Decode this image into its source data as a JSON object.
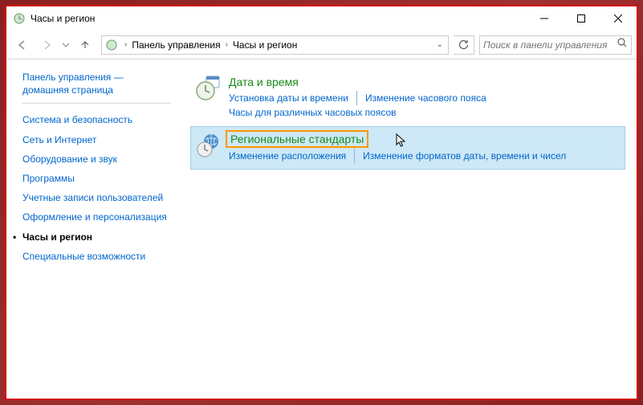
{
  "window": {
    "title": "Часы и регион"
  },
  "address": {
    "seg1": "Панель управления",
    "seg2": "Часы и регион"
  },
  "search": {
    "placeholder": "Поиск в панели управления"
  },
  "sidebar": {
    "header": "Панель управления — домашняя страница",
    "items": [
      "Система и безопасность",
      "Сеть и Интернет",
      "Оборудование и звук",
      "Программы",
      "Учетные записи пользователей",
      "Оформление и персонализация",
      "Часы и регион",
      "Специальные возможности"
    ]
  },
  "panels": {
    "datetime": {
      "title": "Дата и время",
      "link1": "Установка даты и времени",
      "link2": "Изменение часового пояса",
      "link3": "Часы для различных часовых поясов"
    },
    "regional": {
      "title": "Региональные стандарты",
      "link1": "Изменение расположения",
      "link2": "Изменение форматов даты, времени и чисел"
    }
  }
}
